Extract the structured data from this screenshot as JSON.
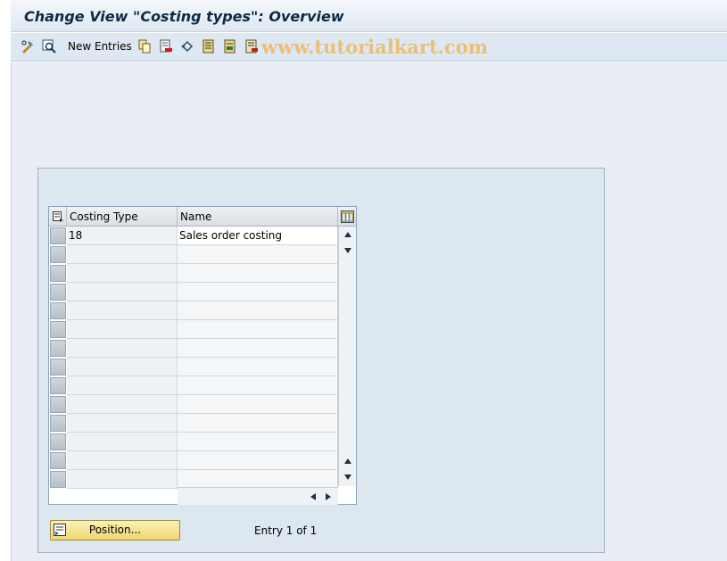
{
  "window": {
    "title": "Change View \"Costing types\": Overview"
  },
  "toolbar": {
    "new_entries_label": "New Entries",
    "icons": [
      "display-change-icon",
      "details-icon",
      "copy-icon",
      "delete-icon",
      "undo-icon",
      "select-all-icon",
      "select-block-icon",
      "deselect-all-icon"
    ]
  },
  "watermark": {
    "text": "www.tutorialkart.com"
  },
  "table": {
    "columns": [
      "Costing Type",
      "Name"
    ],
    "rows": [
      [
        "18",
        "Sales order costing"
      ],
      [
        "",
        ""
      ],
      [
        "",
        ""
      ],
      [
        "",
        ""
      ],
      [
        "",
        ""
      ],
      [
        "",
        ""
      ],
      [
        "",
        ""
      ],
      [
        "",
        ""
      ],
      [
        "",
        ""
      ],
      [
        "",
        ""
      ],
      [
        "",
        ""
      ],
      [
        "",
        ""
      ],
      [
        "",
        ""
      ],
      [
        "",
        ""
      ]
    ]
  },
  "footer": {
    "position_button_label": "Position...",
    "entry_text": "Entry 1 of 1"
  },
  "colors": {
    "title_text": "#0d2a44",
    "watermark": "#f0b24f",
    "position_button": "#f0d66f",
    "background": "#e8eef4"
  }
}
